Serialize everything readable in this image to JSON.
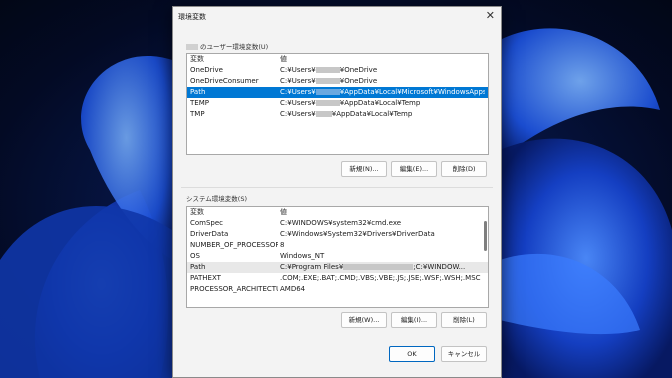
{
  "dialog": {
    "title": "環境変数",
    "close_glyph": "✕",
    "user_group_label": "のユーザー環境変数(U)",
    "system_group_label": "システム環境変数(S)",
    "ok_label": "OK",
    "cancel_label": "キャンセル"
  },
  "user_vars": {
    "header": {
      "name": "変数",
      "value": "値"
    },
    "rows": [
      {
        "name": "OneDrive",
        "pre": "C:¥Users¥",
        "post": "¥OneDrive"
      },
      {
        "name": "OneDriveConsumer",
        "pre": "C:¥Users¥",
        "post": "¥OneDrive"
      },
      {
        "name": "Path",
        "pre": "C:¥Users¥",
        "post": "¥AppData¥Local¥Microsoft¥WindowsApps;C:¥..."
      },
      {
        "name": "TEMP",
        "pre": "C:¥Users¥",
        "post": "¥AppData¥Local¥Temp"
      },
      {
        "name": "TMP",
        "pre": "C:¥Users¥",
        "post": "¥AppData¥Local¥Temp"
      }
    ],
    "buttons": {
      "new": "新規(N)...",
      "edit": "編集(E)...",
      "delete": "削除(D)"
    }
  },
  "system_vars": {
    "header": {
      "name": "変数",
      "value": "値"
    },
    "rows": [
      {
        "name": "ComSpec",
        "value": "C:¥WINDOWS¥system32¥cmd.exe"
      },
      {
        "name": "DriverData",
        "value": "C:¥Windows¥System32¥Drivers¥DriverData"
      },
      {
        "name": "NUMBER_OF_PROCESSORS",
        "value": "8"
      },
      {
        "name": "OS",
        "value": "Windows_NT"
      },
      {
        "name": "Path",
        "pre": "C:¥Program Files¥",
        "post": ";C:¥WINDOW..."
      },
      {
        "name": "PATHEXT",
        "value": ".COM;.EXE;.BAT;.CMD;.VBS;.VBE;.JS;.JSE;.WSF;.WSH;.MSC"
      },
      {
        "name": "PROCESSOR_ARCHITECTU...",
        "value": "AMD64"
      }
    ],
    "buttons": {
      "new": "新規(W)...",
      "edit": "編集(I)...",
      "delete": "削除(L)"
    }
  }
}
